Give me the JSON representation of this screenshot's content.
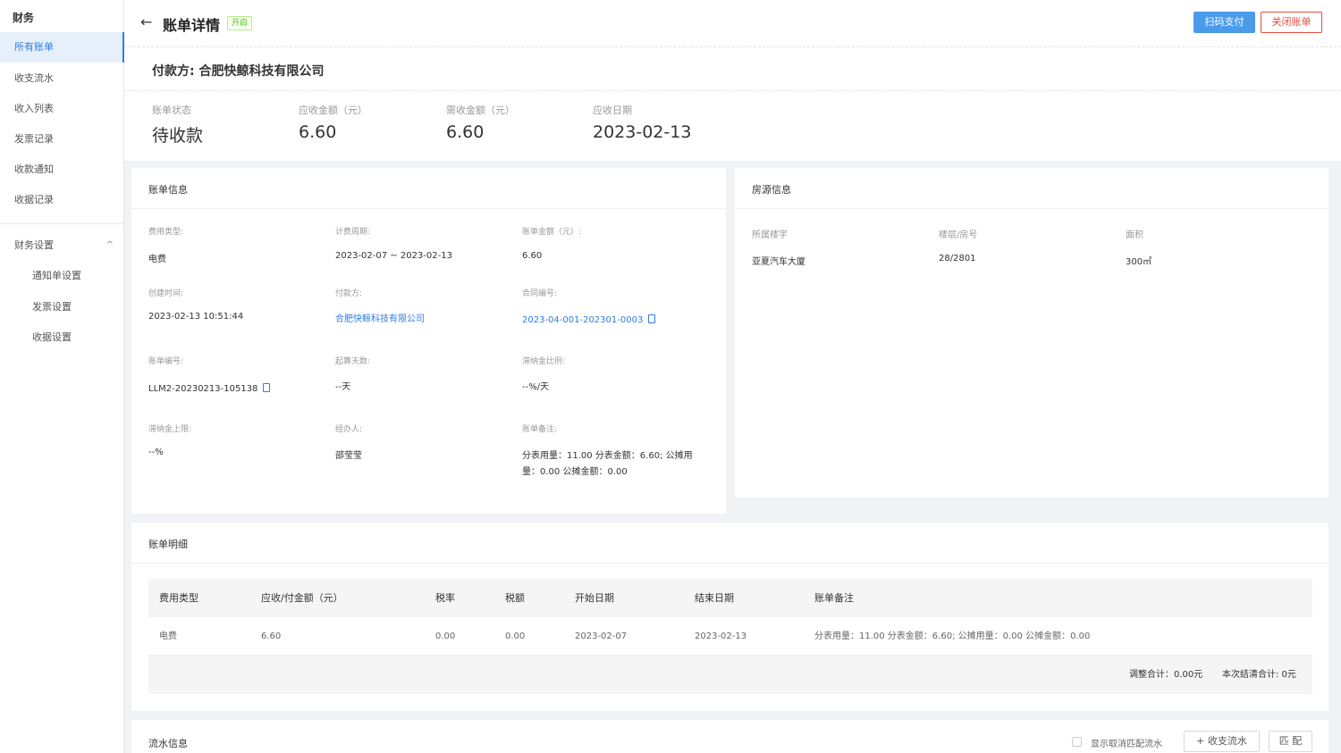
{
  "sidebar": {
    "title": "财务",
    "items": [
      {
        "label": "所有账单"
      },
      {
        "label": "收支流水"
      },
      {
        "label": "收入列表"
      },
      {
        "label": "发票记录"
      },
      {
        "label": "收款通知"
      },
      {
        "label": "收据记录"
      }
    ],
    "group": {
      "label": "财务设置",
      "chevron": "^"
    },
    "sub_items": [
      {
        "label": "通知单设置"
      },
      {
        "label": "发票设置"
      },
      {
        "label": "收据设置"
      }
    ]
  },
  "header": {
    "back": "←",
    "title": "账单详情",
    "tag": "开启",
    "scan_pay_label": "扫码支付",
    "close_bill_label": "关闭账单",
    "payer": "付款方: 合肥快鲸科技有限公司"
  },
  "summary": [
    {
      "label": "账单状态",
      "value": "待收款"
    },
    {
      "label": "应收金额（元）",
      "value": "6.60"
    },
    {
      "label": "需收金额（元）",
      "value": "6.60"
    },
    {
      "label": "应收日期",
      "value": "2023-02-13"
    }
  ],
  "bill_info": {
    "title": "账单信息",
    "fields": {
      "fee_type": {
        "label": "费用类型:",
        "value": "电费"
      },
      "period": {
        "label": "计费周期:",
        "value": "2023-02-07 ~ 2023-02-13"
      },
      "amount": {
        "label": "账单金额（元）:",
        "value": "6.60"
      },
      "created": {
        "label": "创建时间:",
        "value": "2023-02-13 10:51:44"
      },
      "payer": {
        "label": "付款方:",
        "value": "合肥快鲸科技有限公司"
      },
      "contract": {
        "label": "合同编号:",
        "value": "2023-04-001-202301-0003"
      },
      "bill_no": {
        "label": "账单编号:",
        "value": "LLM2-20230213-105138"
      },
      "start_days": {
        "label": "起算天数:",
        "value": "--天"
      },
      "late_ratio": {
        "label": "滞纳金比例:",
        "value": "--%/天"
      },
      "late_cap": {
        "label": "滞纳金上限:",
        "value": "--%"
      },
      "handler": {
        "label": "经办人:",
        "value": "邵莹莹"
      },
      "remark": {
        "label": "账单备注:",
        "value_line1": "分表用量：11.00 分表金额：6.60; 公摊用",
        "value_line2": "量：0.00 公摊金额：0.00"
      }
    }
  },
  "property_info": {
    "title": "房源信息",
    "fields": [
      {
        "label": "所属楼宇",
        "value": "亚夏汽车大厦"
      },
      {
        "label": "楼层/房号",
        "value": "28/2801"
      },
      {
        "label": "面积",
        "value": "300㎡"
      }
    ]
  },
  "bill_detail": {
    "title": "账单明细",
    "columns": [
      "费用类型",
      "应收/付金额（元）",
      "税率",
      "税额",
      "开始日期",
      "结束日期",
      "账单备注"
    ],
    "rows": [
      [
        "电费",
        "6.60",
        "0.00",
        "0.00",
        "2023-02-07",
        "2023-02-13",
        "分表用量：11.00 分表金额：6.60; 公摊用量：0.00 公摊金额：0.00"
      ]
    ],
    "adjust_total": "调整合计：0.00元",
    "settle_total": "本次结清合计: 0元"
  },
  "flow_info": {
    "title": "流水信息",
    "show_cancelled_label": "显示取消匹配流水",
    "add_flow_label": "+ 收支流水",
    "match_label": "匹 配"
  },
  "colors": {
    "primary": "#4a9bea",
    "link": "#2f7de1",
    "danger": "#e74c3c",
    "success": "#52c41a"
  }
}
